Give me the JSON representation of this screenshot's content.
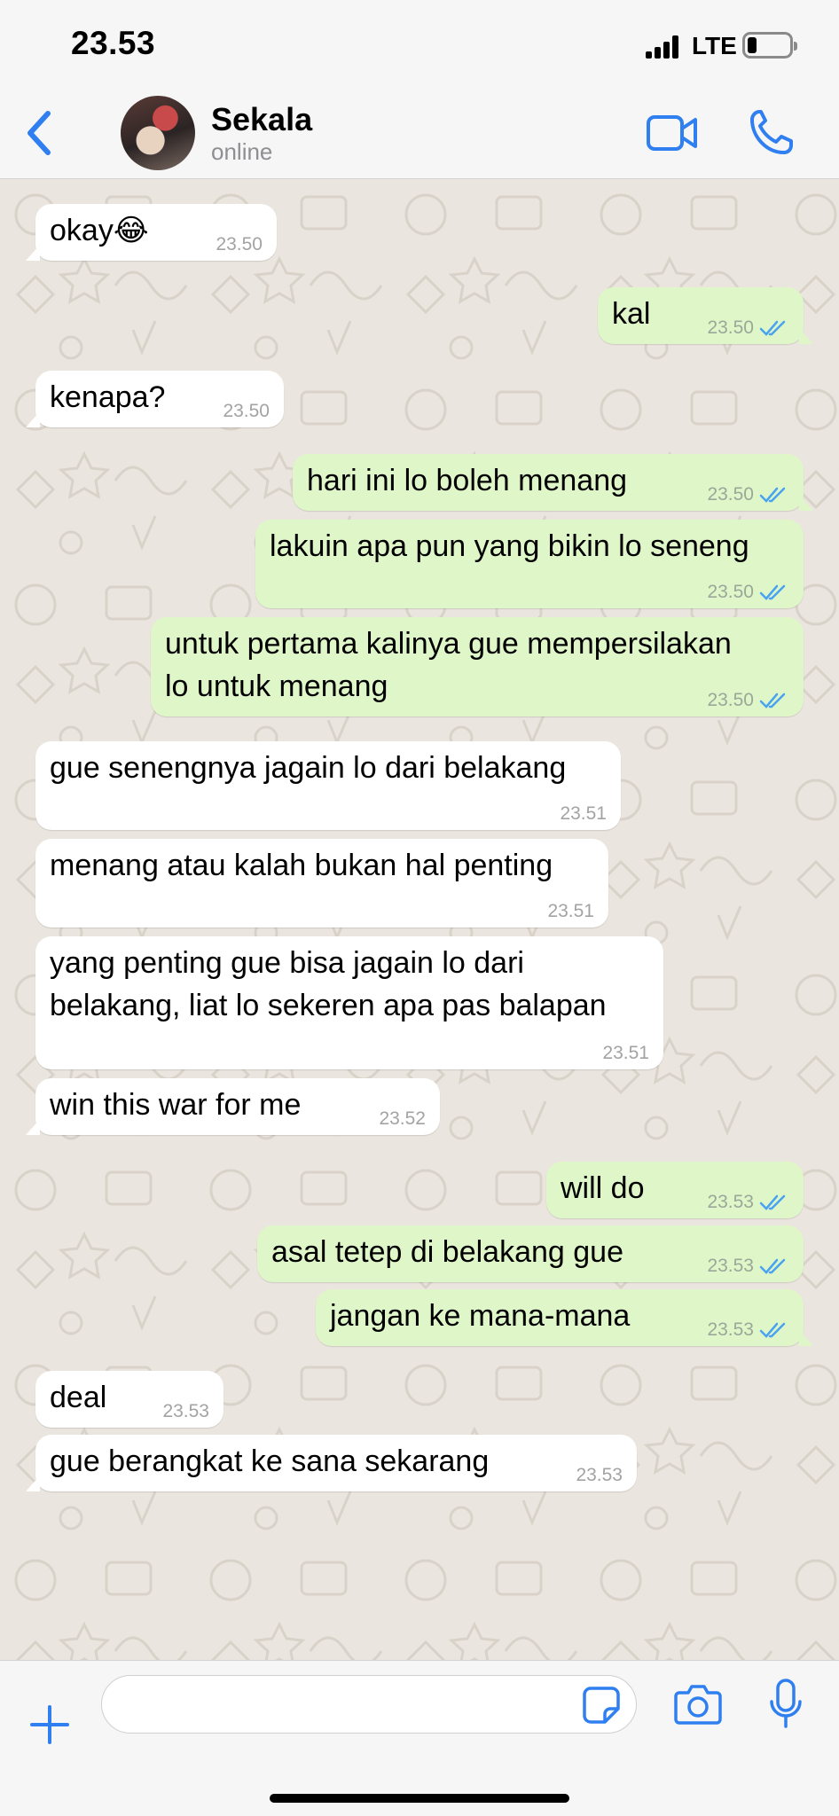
{
  "status_bar": {
    "time": "23.53",
    "network": "LTE"
  },
  "header": {
    "contact_name": "Sekala",
    "contact_status": "online"
  },
  "messages": [
    {
      "dir": "in",
      "text": "okay😂",
      "time": "23.50"
    },
    {
      "dir": "out",
      "text": "kal",
      "time": "23.50",
      "read": true
    },
    {
      "dir": "in",
      "text": "kenapa?",
      "time": "23.50"
    },
    {
      "dir": "out",
      "text": "hari ini lo boleh menang",
      "time": "23.50",
      "read": true
    },
    {
      "dir": "out",
      "text": "lakuin apa pun yang bikin lo seneng",
      "time": "23.50",
      "read": true
    },
    {
      "dir": "out",
      "text": "untuk pertama kalinya gue mempersilakan\nlo untuk menang",
      "time": "23.50",
      "read": true
    },
    {
      "dir": "in",
      "text": "gue senengnya jagain lo dari belakang",
      "time": "23.51"
    },
    {
      "dir": "in",
      "text": "menang atau kalah bukan hal penting",
      "time": "23.51"
    },
    {
      "dir": "in",
      "text": "yang penting gue bisa jagain lo dari\nbelakang, liat lo sekeren apa pas balapan",
      "time": "23.51"
    },
    {
      "dir": "in",
      "text": "win this war for me",
      "time": "23.52"
    },
    {
      "dir": "out",
      "text": "will do",
      "time": "23.53",
      "read": true
    },
    {
      "dir": "out",
      "text": "asal tetep di belakang gue",
      "time": "23.53",
      "read": true
    },
    {
      "dir": "out",
      "text": "jangan ke mana-mana",
      "time": "23.53",
      "read": true
    },
    {
      "dir": "in",
      "text": "deal",
      "time": "23.53"
    },
    {
      "dir": "in",
      "text": "gue berangkat ke sana sekarang",
      "time": "23.53"
    }
  ],
  "composer": {
    "input_value": ""
  },
  "colors": {
    "accent": "#2f7ff0",
    "incoming_bubble": "#ffffff",
    "outgoing_bubble": "#dff7c8",
    "read_ticks": "#4aa3f0",
    "chat_background": "#ebe5df"
  },
  "icons": {
    "back": "chevron-left-icon",
    "video": "video-camera-icon",
    "call": "phone-icon",
    "attach": "plus-icon",
    "sticker": "sticker-icon",
    "camera": "camera-icon",
    "mic": "microphone-icon",
    "read": "double-check-icon"
  }
}
